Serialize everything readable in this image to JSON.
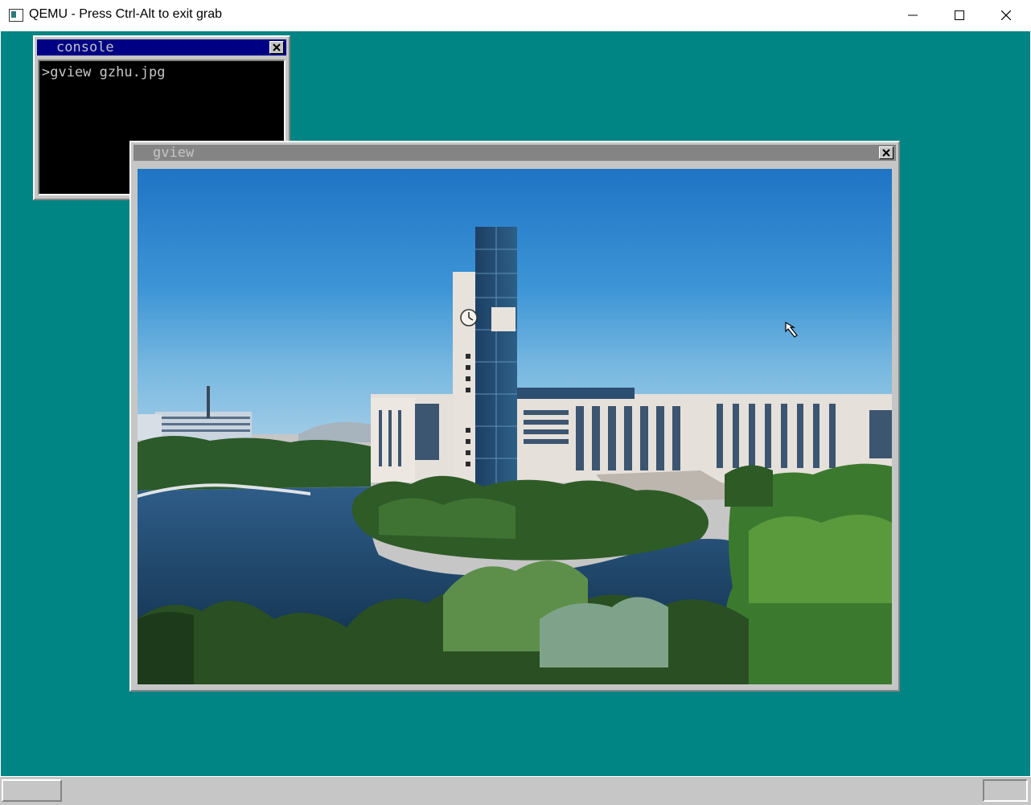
{
  "host_window": {
    "title": "QEMU - Press Ctrl-Alt to exit grab",
    "icon": "qemu-app-icon",
    "controls": [
      "minimize-icon",
      "maximize-icon",
      "close-icon"
    ]
  },
  "desktop": {
    "background_color": "#008484"
  },
  "console_window": {
    "title": "console",
    "prompt_line": ">gview gzhu.jpg",
    "title_bar_color": "#000084"
  },
  "gview_window": {
    "title": "gview",
    "image_description_icon": "photo-image",
    "title_bar_color": "#848484"
  },
  "taskbar": {
    "start_button_label": "",
    "tray_label": ""
  },
  "cursor": {
    "icon": "arrow-cursor-icon"
  }
}
